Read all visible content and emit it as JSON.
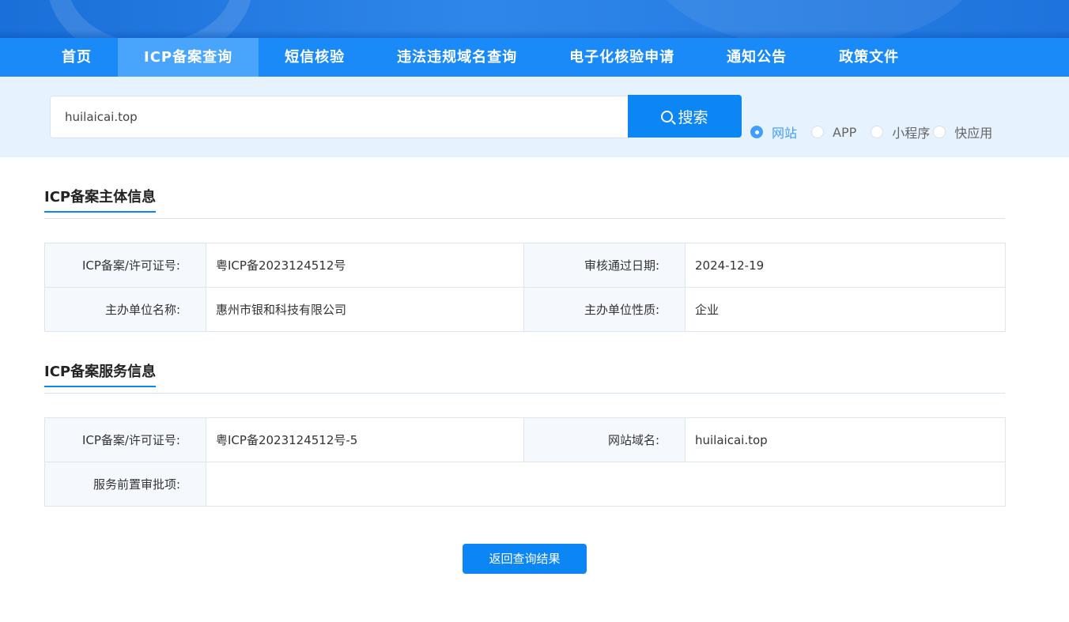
{
  "nav": {
    "items": [
      "首页",
      "ICP备案查询",
      "短信核验",
      "违法违规域名查询",
      "电子化核验申请",
      "通知公告",
      "政策文件"
    ],
    "active_index": 1
  },
  "search": {
    "value": "huilaicai.top",
    "button_label": "搜索",
    "types": [
      "网站",
      "APP",
      "小程序",
      "快应用"
    ],
    "selected_type": "网站"
  },
  "subject_info": {
    "title": "ICP备案主体信息",
    "rows": [
      {
        "label1": "ICP备案/许可证号:",
        "value1": "粤ICP备2023124512号",
        "label2": "审核通过日期:",
        "value2": "2024-12-19"
      },
      {
        "label1": "主办单位名称:",
        "value1": "惠州市银和科技有限公司",
        "label2": "主办单位性质:",
        "value2": "企业"
      }
    ]
  },
  "service_info": {
    "title": "ICP备案服务信息",
    "row1": {
      "label1": "ICP备案/许可证号:",
      "value1": "粤ICP备2023124512号-5",
      "label2": "网站域名:",
      "value2": "huilaicai.top"
    },
    "row2": {
      "label1": "服务前置审批项:",
      "value1": ""
    }
  },
  "back_button_label": "返回查询结果",
  "colors": {
    "primary": "#0d86f5",
    "nav_bg": "#1a8af9",
    "nav_active": "#49a5fb",
    "search_band": "#e6f2fd"
  }
}
